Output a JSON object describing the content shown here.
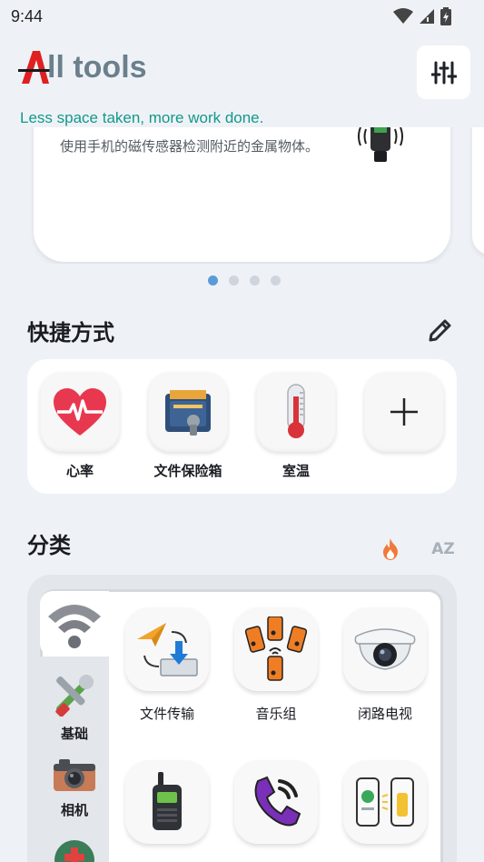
{
  "status_bar": {
    "time": "9:44"
  },
  "header": {
    "logo_letter": "A",
    "title": "ll tools",
    "tagline": "Less space taken, more work done."
  },
  "carousel": {
    "description": "使用手机的磁传感器检测附近的金属物体。",
    "dots": 4,
    "active_dot": 0
  },
  "shortcuts": {
    "title": "快捷方式",
    "items": [
      {
        "label": "心率",
        "icon": "heart-rate-icon"
      },
      {
        "label": "文件保险箱",
        "icon": "file-vault-icon"
      },
      {
        "label": "室温",
        "icon": "thermometer-icon"
      },
      {
        "label": "",
        "icon": "add-icon"
      }
    ]
  },
  "categories": {
    "title": "分类",
    "sort_az_label": "AZ",
    "rail": [
      {
        "label": "",
        "icon": "wifi-icon",
        "selected": true
      },
      {
        "label": "基础",
        "icon": "tools-icon"
      },
      {
        "label": "相机",
        "icon": "camera-icon"
      },
      {
        "label": "",
        "icon": "medical-icon"
      }
    ],
    "tools": [
      {
        "label": "文件传输",
        "icon": "file-transfer-icon"
      },
      {
        "label": "音乐组",
        "icon": "music-group-icon"
      },
      {
        "label": "闭路电视",
        "icon": "cctv-icon"
      },
      {
        "label": "",
        "icon": "walkie-talkie-icon"
      },
      {
        "label": "",
        "icon": "phone-call-icon"
      },
      {
        "label": "",
        "icon": "phone-flashlight-icon"
      }
    ]
  },
  "colors": {
    "accent_teal": "#14988a",
    "logo_red": "#e02020",
    "dot_active": "#5b9bd9",
    "hot_orange": "#f07a3a"
  }
}
